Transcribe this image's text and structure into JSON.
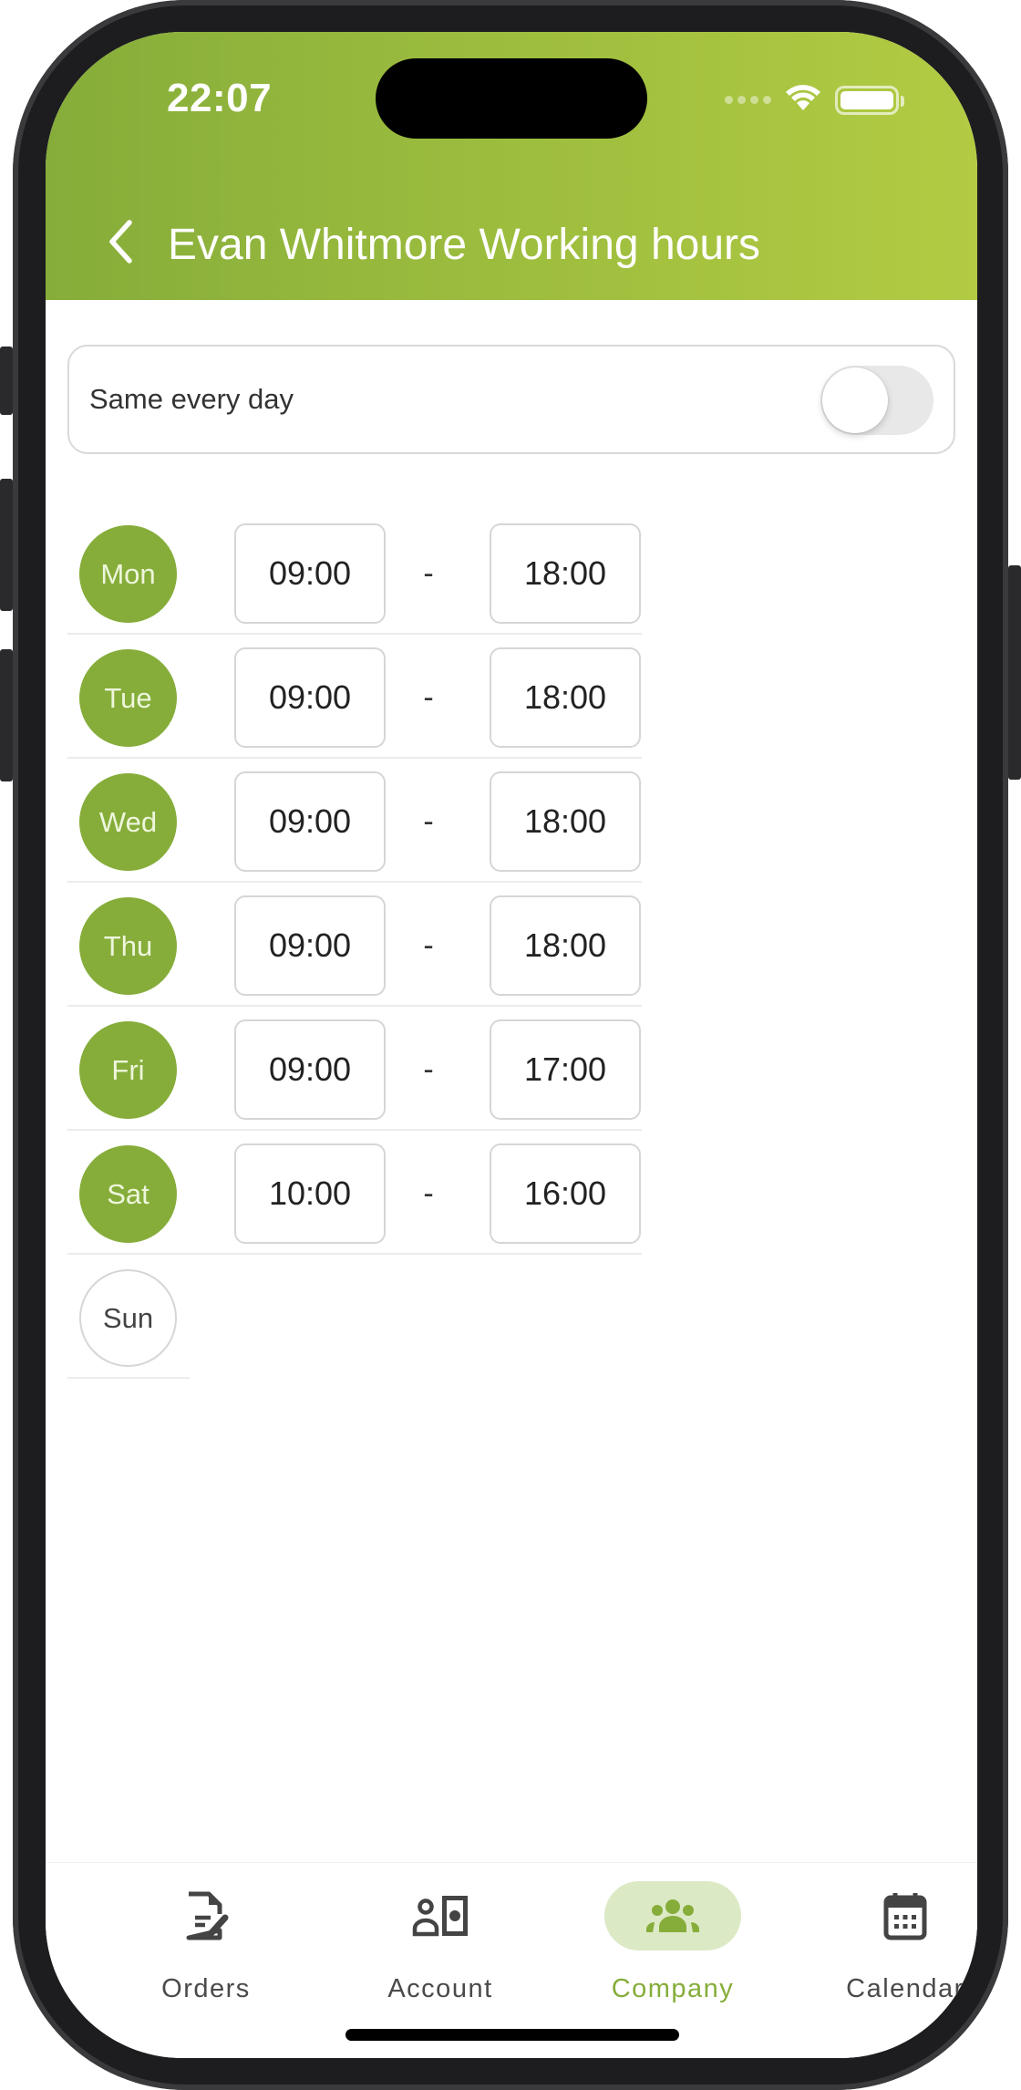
{
  "status_bar": {
    "time": "22:07",
    "icons": [
      "cellular-dots-icon",
      "wifi-icon",
      "battery-icon"
    ]
  },
  "header": {
    "back_icon": "chevron-left-icon",
    "title": "Evan Whitmore Working hours"
  },
  "same_every_day": {
    "label": "Same every day",
    "enabled": false
  },
  "days": [
    {
      "label": "Mon",
      "active": true,
      "start": "09:00",
      "separator": "-",
      "end": "18:00"
    },
    {
      "label": "Tue",
      "active": true,
      "start": "09:00",
      "separator": "-",
      "end": "18:00"
    },
    {
      "label": "Wed",
      "active": true,
      "start": "09:00",
      "separator": "-",
      "end": "18:00"
    },
    {
      "label": "Thu",
      "active": true,
      "start": "09:00",
      "separator": "-",
      "end": "18:00"
    },
    {
      "label": "Fri",
      "active": true,
      "start": "09:00",
      "separator": "-",
      "end": "17:00"
    },
    {
      "label": "Sat",
      "active": true,
      "start": "10:00",
      "separator": "-",
      "end": "16:00"
    },
    {
      "label": "Sun",
      "active": false
    }
  ],
  "tabbar": {
    "items": [
      {
        "label": "Orders",
        "icon": "document-edit-icon",
        "active": false
      },
      {
        "label": "Account",
        "icon": "user-money-icon",
        "active": false
      },
      {
        "label": "Company",
        "icon": "group-icon",
        "active": true
      },
      {
        "label": "Calendar",
        "icon": "calendar-icon",
        "active": false
      }
    ]
  },
  "colors": {
    "brand_green": "#86ad3a",
    "header_gradient_end": "#b2cb43",
    "active_tab_bg": "#dce9c5"
  }
}
